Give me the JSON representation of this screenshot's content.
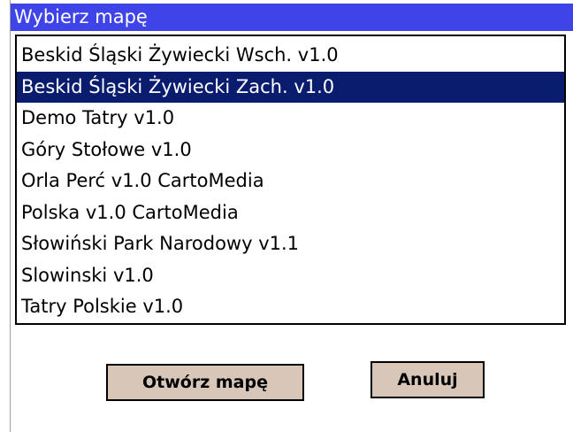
{
  "dialog": {
    "title": "Wybierz mapę"
  },
  "maps": {
    "selected_index": 1,
    "items": [
      "Beskid Śląski Żywiecki Wsch. v1.0",
      "Beskid Śląski Żywiecki Zach. v1.0",
      "Demo Tatry v1.0",
      "Góry Stołowe v1.0",
      "Orla Perć v1.0 CartoMedia",
      "Polska v1.0 CartoMedia",
      "Słowiński Park Narodowy v1.1",
      "Slowinski v1.0",
      "Tatry Polskie v1.0"
    ]
  },
  "buttons": {
    "open_label": "Otwórz mapę",
    "cancel_label": "Anuluj"
  },
  "colors": {
    "title_bg": "#3f44e8",
    "selection_bg": "#0a1c6e",
    "button_bg": "#d8c7b9"
  }
}
